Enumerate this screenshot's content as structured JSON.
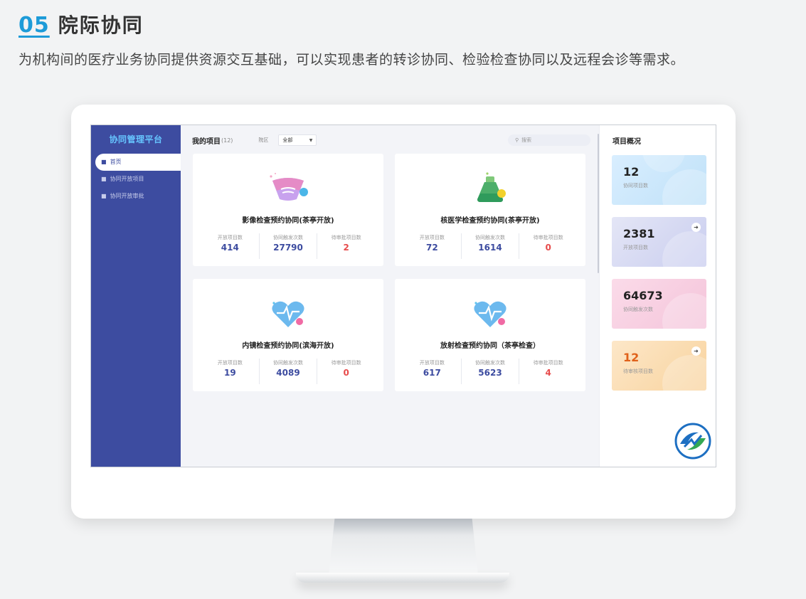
{
  "section": {
    "number": "05",
    "title": "院际协同",
    "description": "为机构间的医疗业务协同提供资源交互基础，可以实现患者的转诊协同、检验检查协同以及远程会诊等需求。"
  },
  "app": {
    "brand": "协同管理平台",
    "nav": [
      {
        "label": "首页",
        "icon": "folder-icon",
        "active": true
      },
      {
        "label": "协同开放项目",
        "icon": "folder-icon",
        "active": false
      },
      {
        "label": "协同开放审批",
        "icon": "folder-icon",
        "active": false
      }
    ]
  },
  "toolbar": {
    "my_projects": "我的项目",
    "count": "(12)",
    "region_label": "院区",
    "region_value": "全部",
    "search_placeholder": "搜索"
  },
  "projects": [
    {
      "title": "影像检查预约协同(茶亭开放)",
      "icon": "ultrasound-icon",
      "stats": [
        {
          "label": "开放项目数",
          "value": "414"
        },
        {
          "label": "协同触发次数",
          "value": "27790"
        },
        {
          "label": "待审批项目数",
          "value": "2"
        }
      ]
    },
    {
      "title": "核医学检查预约协同(茶亭开放)",
      "icon": "flask-icon",
      "stats": [
        {
          "label": "开放项目数",
          "value": "72"
        },
        {
          "label": "协同触发次数",
          "value": "1614"
        },
        {
          "label": "待审批项目数",
          "value": "0"
        }
      ]
    },
    {
      "title": "内镜检查预约协同(滨海开放)",
      "icon": "heart-pulse-icon",
      "stats": [
        {
          "label": "开放项目数",
          "value": "19"
        },
        {
          "label": "协同触发次数",
          "value": "4089"
        },
        {
          "label": "待审批项目数",
          "value": "0"
        }
      ]
    },
    {
      "title": "放射检查预约协同（茶亭检查）",
      "icon": "heart-pulse-icon",
      "stats": [
        {
          "label": "开放项目数",
          "value": "617"
        },
        {
          "label": "协同触发次数",
          "value": "5623"
        },
        {
          "label": "待审批项目数",
          "value": "4"
        }
      ]
    }
  ],
  "overview": {
    "title": "项目概况",
    "cards": [
      {
        "value": "12",
        "label": "协同项目数"
      },
      {
        "value": "2381",
        "label": "开放项目数"
      },
      {
        "value": "64673",
        "label": "协同触发次数"
      },
      {
        "value": "12",
        "label": "待审核项目数"
      }
    ]
  },
  "colors": {
    "sidebar": "#3d4ca0",
    "accent": "#1d9bd8",
    "pending": "#e74c4c"
  }
}
